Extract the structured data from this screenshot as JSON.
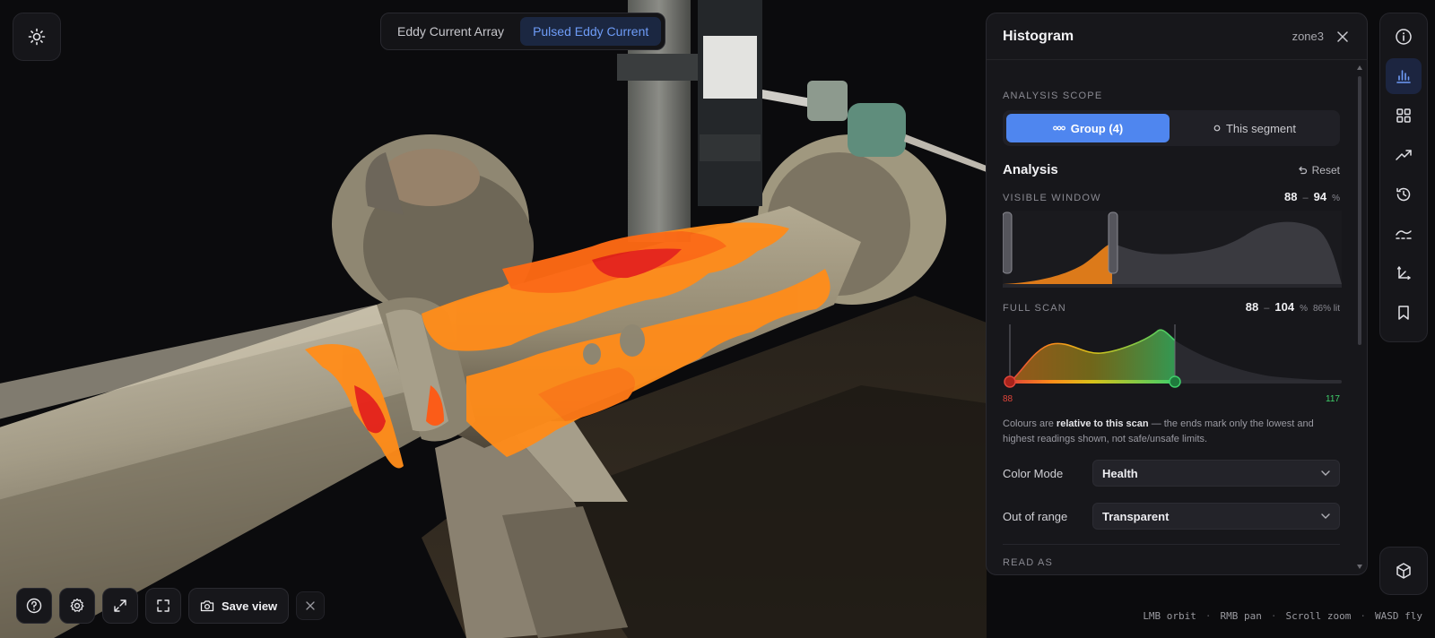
{
  "modes": [
    {
      "label": "Eddy Current Array",
      "active": false
    },
    {
      "label": "Pulsed Eddy Current",
      "active": true
    }
  ],
  "panel": {
    "title": "Histogram",
    "zone": "zone3",
    "analysis_scope_label": "ANALYSIS SCOPE",
    "scope_group_label": "Group (4)",
    "scope_segment_label": "This segment",
    "analysis_title": "Analysis",
    "reset_label": "Reset",
    "visible_window": {
      "label": "VISIBLE WINDOW",
      "min": "88",
      "max": "94",
      "unit": "%"
    },
    "full_scan": {
      "label": "FULL SCAN",
      "min": "88",
      "max": "104",
      "unit": "%",
      "lit": "86% lit",
      "min_tick": "88",
      "max_tick": "117"
    },
    "note_pre": "Colours are ",
    "note_bold": "relative to this scan",
    "note_post": " — the ends mark only the lowest and highest readings shown, not safe/unsafe limits.",
    "color_mode_label": "Color Mode",
    "color_mode_value": "Health",
    "out_of_range_label": "Out of range",
    "out_of_range_value": "Transparent",
    "read_as_label": "READ AS"
  },
  "bottom": {
    "save_view_label": "Save view"
  },
  "hints": [
    "LMB orbit",
    "RMB pan",
    "Scroll zoom",
    "WASD fly"
  ],
  "colors": {
    "accent": "#4f86ef",
    "heat_low": "#ff8c1a",
    "heat_high": "#e8241a",
    "health_green": "#3fcf6a"
  }
}
